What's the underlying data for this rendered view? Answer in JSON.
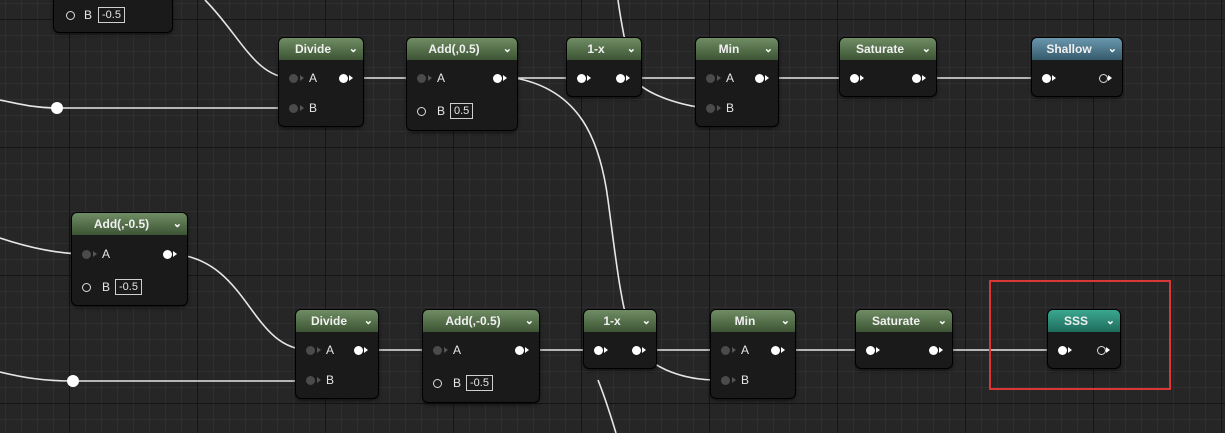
{
  "graph": {
    "partial_node": {
      "pin_b": "B",
      "b_value": "-0.5"
    },
    "row1": {
      "divide": {
        "title": "Divide",
        "pin_a": "A",
        "pin_b": "B"
      },
      "add": {
        "title": "Add(,0.5)",
        "pin_a": "A",
        "pin_b": "B",
        "b_value": "0.5"
      },
      "oneminus": {
        "title": "1-x"
      },
      "min": {
        "title": "Min",
        "pin_a": "A",
        "pin_b": "B"
      },
      "saturate": {
        "title": "Saturate"
      },
      "output": {
        "title": "Shallow"
      }
    },
    "mid": {
      "add": {
        "title": "Add(,-0.5)",
        "pin_a": "A",
        "pin_b": "B",
        "b_value": "-0.5"
      }
    },
    "row2": {
      "divide": {
        "title": "Divide",
        "pin_a": "A",
        "pin_b": "B"
      },
      "add": {
        "title": "Add(,-0.5)",
        "pin_a": "A",
        "pin_b": "B",
        "b_value": "-0.5"
      },
      "oneminus": {
        "title": "1-x"
      },
      "min": {
        "title": "Min",
        "pin_a": "A",
        "pin_b": "B"
      },
      "saturate": {
        "title": "Saturate"
      },
      "output": {
        "title": "SSS"
      }
    },
    "colors": {
      "math_header": "#4f6d44",
      "shallow_header": "#477a92",
      "sss_header": "#2e8f7a",
      "selection_outline": "#d93636",
      "wire": "#e8e8e8"
    },
    "chevron_icon": "chevron-down-icon"
  }
}
